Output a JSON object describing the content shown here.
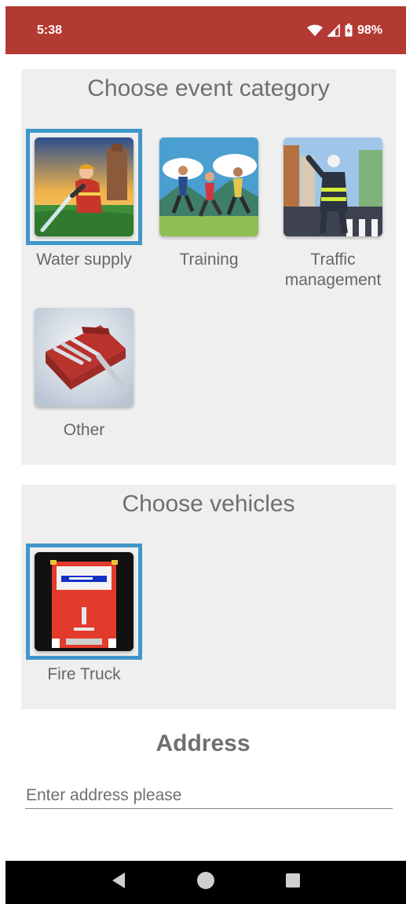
{
  "status_bar": {
    "time": "5:38",
    "battery_percent": "98%",
    "icons": [
      "wifi-icon",
      "cell-signal-icon",
      "battery-icon"
    ],
    "background": "#b33a33"
  },
  "event_category": {
    "title": "Choose event category",
    "items": [
      {
        "label": "Water supply",
        "selected": true,
        "icon": "firefighter-hose-image"
      },
      {
        "label": "Training",
        "selected": false,
        "icon": "runners-image"
      },
      {
        "label": "Traffic management",
        "selected": false,
        "icon": "traffic-officer-image"
      },
      {
        "label": "Other",
        "selected": false,
        "icon": "toolbox-image"
      }
    ]
  },
  "vehicles": {
    "title": "Choose vehicles",
    "items": [
      {
        "label": "Fire Truck",
        "selected": true,
        "icon": "fire-truck-image"
      }
    ]
  },
  "address": {
    "title": "Address",
    "placeholder": "Enter address please",
    "value": ""
  },
  "nav_bar": {
    "buttons": [
      "back-icon",
      "home-icon",
      "recents-icon"
    ]
  },
  "colors": {
    "selection_border": "#3f97c9",
    "panel_background": "#efefef",
    "text_gray": "#6f6f6f"
  }
}
